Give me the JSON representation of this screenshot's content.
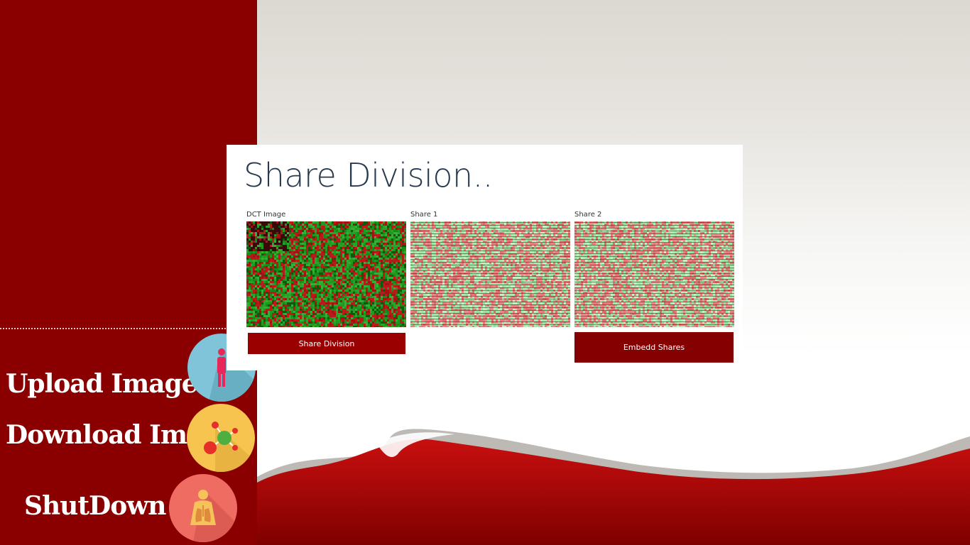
{
  "sidebar": {
    "menu": [
      {
        "label": "Upload Image",
        "icon": "person-icon"
      },
      {
        "label": "Download Image",
        "icon": "molecule-icon"
      },
      {
        "label": "ShutDown",
        "icon": "lungs-icon"
      }
    ]
  },
  "panel": {
    "title": "Share Division..",
    "images": [
      {
        "caption": "DCT Image"
      },
      {
        "caption": "Share 1"
      },
      {
        "caption": "Share 2"
      }
    ],
    "share_division_label": "Share Division",
    "embed_shares_label": "Embedd Shares"
  },
  "colors": {
    "sidebar": "#8a0000",
    "button": "#9b0000",
    "button_dark": "#850000",
    "title": "#27394f",
    "accent_wave": "#c20b0b"
  }
}
